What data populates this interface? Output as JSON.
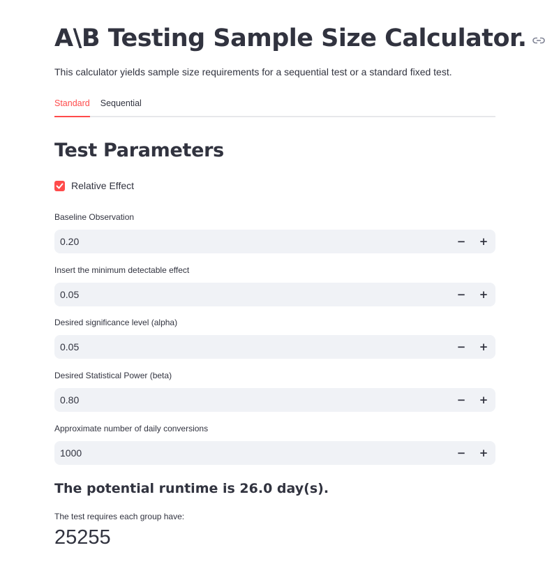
{
  "header": {
    "title": "A\\B Testing Sample Size Calculator.",
    "subtitle": "This calculator yields sample size requirements for a sequential test or a standard fixed test."
  },
  "tabs": [
    {
      "label": "Standard",
      "active": true
    },
    {
      "label": "Sequential",
      "active": false
    }
  ],
  "section": {
    "title": "Test Parameters"
  },
  "relative_effect": {
    "label": "Relative Effect",
    "checked": true
  },
  "fields": [
    {
      "label": "Baseline Observation",
      "value": "0.20"
    },
    {
      "label": "Insert the minimum detectable effect",
      "value": "0.05"
    },
    {
      "label": "Desired significance level (alpha)",
      "value": "0.05"
    },
    {
      "label": "Desired Statistical Power (beta)",
      "value": "0.80"
    },
    {
      "label": "Approximate number of daily conversions",
      "value": "1000"
    }
  ],
  "result": {
    "runtime": "The potential runtime is 26.0 day(s).",
    "metric_label": "The test requires each group have:",
    "metric_value": "25255"
  },
  "colors": {
    "accent": "#ff4b4b",
    "input_bg": "#f0f2f6",
    "text": "#31333f"
  }
}
